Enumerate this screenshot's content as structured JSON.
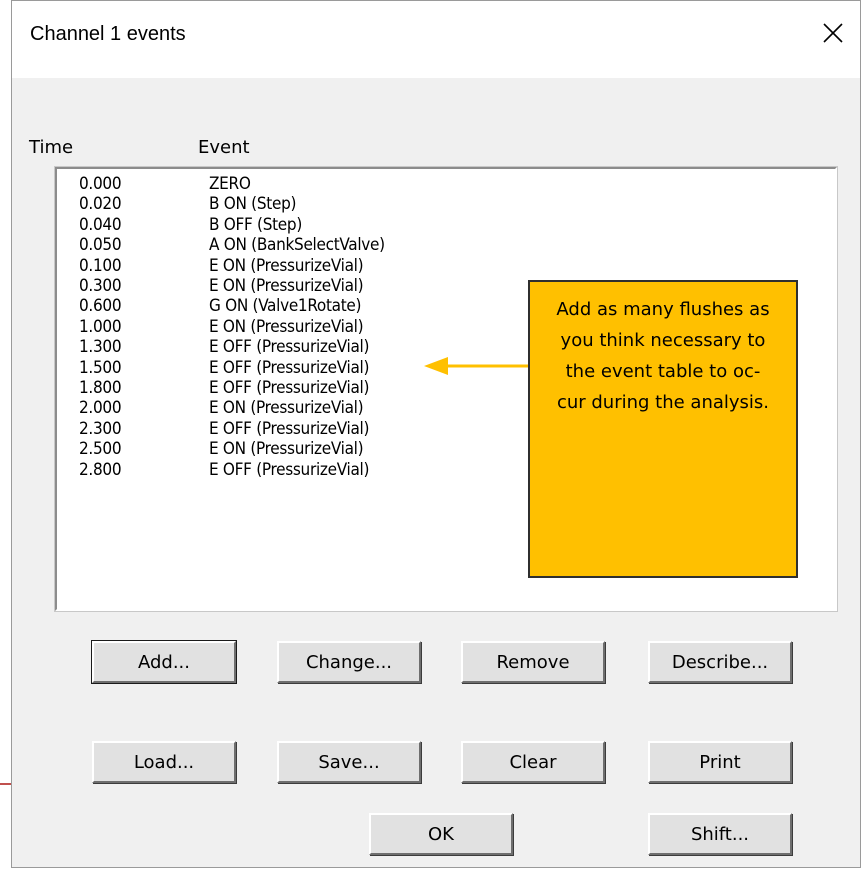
{
  "window": {
    "title": "Channel 1 events",
    "close_icon": "close-icon"
  },
  "columns": {
    "time": "Time",
    "event": "Event"
  },
  "events": [
    {
      "time": "0.000",
      "event": "ZERO"
    },
    {
      "time": "0.020",
      "event": "B ON (Step)"
    },
    {
      "time": "0.040",
      "event": "B OFF (Step)"
    },
    {
      "time": "0.050",
      "event": "A ON (BankSelectValve)"
    },
    {
      "time": "0.100",
      "event": "E ON (PressurizeVial)"
    },
    {
      "time": "0.300",
      "event": "E ON (PressurizeVial)"
    },
    {
      "time": "0.600",
      "event": "G ON (Valve1Rotate)"
    },
    {
      "time": "1.000",
      "event": "E ON (PressurizeVial)"
    },
    {
      "time": "1.300",
      "event": "E OFF (PressurizeVial)"
    },
    {
      "time": "1.500",
      "event": "E OFF (PressurizeVial)"
    },
    {
      "time": "1.800",
      "event": "E OFF (PressurizeVial)"
    },
    {
      "time": "2.000",
      "event": "E ON (PressurizeVial)"
    },
    {
      "time": "2.300",
      "event": "E OFF (PressurizeVial)"
    },
    {
      "time": "2.500",
      "event": "E ON (PressurizeVial)"
    },
    {
      "time": "2.800",
      "event": "E OFF (PressurizeVial)"
    }
  ],
  "callout": {
    "text": "Add as many flushes as you think necessary to the event table to oc-cur during the analysis.",
    "lines": [
      "Add as many flushes as",
      "you think necessary to",
      "the event table to oc-",
      "cur during the analysis."
    ],
    "color": "#ffc000"
  },
  "buttons": {
    "add": "Add...",
    "change": "Change...",
    "remove": "Remove",
    "describe": "Describe...",
    "load": "Load...",
    "save": "Save...",
    "clear": "Clear",
    "print": "Print",
    "ok": "OK",
    "shift": "Shift..."
  }
}
